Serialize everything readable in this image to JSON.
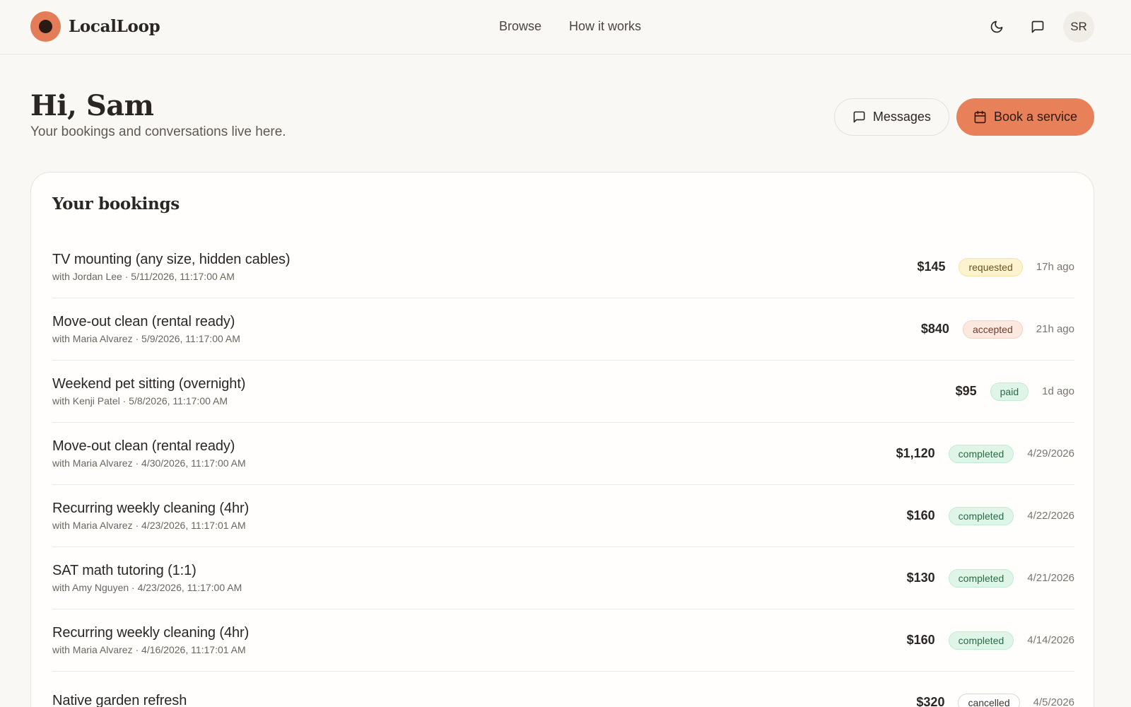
{
  "brand": {
    "name": "LocalLoop"
  },
  "nav": {
    "items": [
      "Browse",
      "How it works"
    ]
  },
  "topbar": {
    "avatar_initials": "SR",
    "theme_icon": "moon-icon",
    "messages_icon": "chat-bubble-icon"
  },
  "greeting": {
    "title": "Hi, Sam",
    "subtitle": "Your bookings and conversations live here."
  },
  "actions": {
    "messages_label": "Messages",
    "book_label": "Book a service"
  },
  "bookings": {
    "title": "Your bookings",
    "rows": [
      {
        "title": "TV mounting (any size, hidden cables)",
        "meta": "with Jordan Lee · 5/11/2026, 11:17:00 AM",
        "price": "$145",
        "status": "requested",
        "when": "17h ago"
      },
      {
        "title": "Move-out clean (rental ready)",
        "meta": "with Maria Alvarez · 5/9/2026, 11:17:00 AM",
        "price": "$840",
        "status": "accepted",
        "when": "21h ago"
      },
      {
        "title": "Weekend pet sitting (overnight)",
        "meta": "with Kenji Patel · 5/8/2026, 11:17:00 AM",
        "price": "$95",
        "status": "paid",
        "when": "1d ago"
      },
      {
        "title": "Move-out clean (rental ready)",
        "meta": "with Maria Alvarez · 4/30/2026, 11:17:00 AM",
        "price": "$1,120",
        "status": "completed",
        "when": "4/29/2026"
      },
      {
        "title": "Recurring weekly cleaning (4hr)",
        "meta": "with Maria Alvarez · 4/23/2026, 11:17:01 AM",
        "price": "$160",
        "status": "completed",
        "when": "4/22/2026"
      },
      {
        "title": "SAT math tutoring (1:1)",
        "meta": "with Amy Nguyen · 4/23/2026, 11:17:00 AM",
        "price": "$130",
        "status": "completed",
        "when": "4/21/2026"
      },
      {
        "title": "Recurring weekly cleaning (4hr)",
        "meta": "with Maria Alvarez · 4/16/2026, 11:17:01 AM",
        "price": "$160",
        "status": "completed",
        "when": "4/14/2026"
      },
      {
        "title": "Native garden refresh",
        "meta": "",
        "price": "$320",
        "status": "cancelled",
        "when": "4/5/2026"
      }
    ]
  }
}
